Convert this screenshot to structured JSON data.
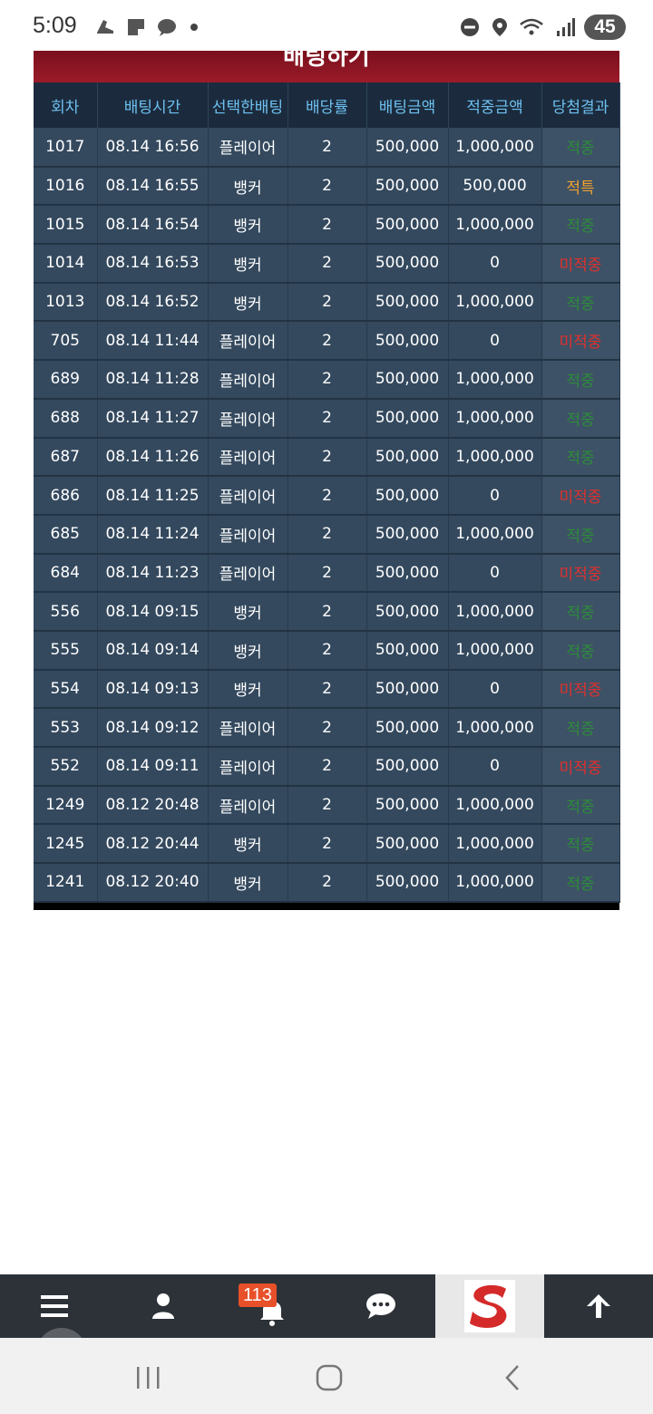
{
  "status_bar": {
    "time": "5:09",
    "battery": "45"
  },
  "panel": {
    "title": "배팅하기"
  },
  "table": {
    "headers": [
      "회차",
      "배팅시간",
      "선택한배팅",
      "배당률",
      "배팅금액",
      "적중금액",
      "당첨결과"
    ],
    "rows": [
      [
        "1017",
        "08.14 16:56",
        "플레이어",
        "2",
        "500,000",
        "1,000,000",
        "적중"
      ],
      [
        "1016",
        "08.14 16:55",
        "뱅커",
        "2",
        "500,000",
        "500,000",
        "적특"
      ],
      [
        "1015",
        "08.14 16:54",
        "뱅커",
        "2",
        "500,000",
        "1,000,000",
        "적중"
      ],
      [
        "1014",
        "08.14 16:53",
        "뱅커",
        "2",
        "500,000",
        "0",
        "미적중"
      ],
      [
        "1013",
        "08.14 16:52",
        "뱅커",
        "2",
        "500,000",
        "1,000,000",
        "적중"
      ],
      [
        "705",
        "08.14 11:44",
        "플레이어",
        "2",
        "500,000",
        "0",
        "미적중"
      ],
      [
        "689",
        "08.14 11:28",
        "플레이어",
        "2",
        "500,000",
        "1,000,000",
        "적중"
      ],
      [
        "688",
        "08.14 11:27",
        "플레이어",
        "2",
        "500,000",
        "1,000,000",
        "적중"
      ],
      [
        "687",
        "08.14 11:26",
        "플레이어",
        "2",
        "500,000",
        "1,000,000",
        "적중"
      ],
      [
        "686",
        "08.14 11:25",
        "플레이어",
        "2",
        "500,000",
        "0",
        "미적중"
      ],
      [
        "685",
        "08.14 11:24",
        "플레이어",
        "2",
        "500,000",
        "1,000,000",
        "적중"
      ],
      [
        "684",
        "08.14 11:23",
        "플레이어",
        "2",
        "500,000",
        "0",
        "미적중"
      ],
      [
        "556",
        "08.14 09:15",
        "뱅커",
        "2",
        "500,000",
        "1,000,000",
        "적중"
      ],
      [
        "555",
        "08.14 09:14",
        "뱅커",
        "2",
        "500,000",
        "1,000,000",
        "적중"
      ],
      [
        "554",
        "08.14 09:13",
        "뱅커",
        "2",
        "500,000",
        "0",
        "미적중"
      ],
      [
        "553",
        "08.14 09:12",
        "플레이어",
        "2",
        "500,000",
        "1,000,000",
        "적중"
      ],
      [
        "552",
        "08.14 09:11",
        "플레이어",
        "2",
        "500,000",
        "0",
        "미적중"
      ],
      [
        "1249",
        "08.12 20:48",
        "플레이어",
        "2",
        "500,000",
        "1,000,000",
        "적중"
      ],
      [
        "1245",
        "08.12 20:44",
        "뱅커",
        "2",
        "500,000",
        "1,000,000",
        "적중"
      ],
      [
        "1241",
        "08.12 20:40",
        "뱅커",
        "2",
        "500,000",
        "1,000,000",
        "적중"
      ]
    ],
    "result_colors": {
      "적중": "#2e8b3a",
      "적특": "#f0a030",
      "미적중": "#e0302e"
    }
  },
  "toolbar": {
    "items": [
      {
        "icon": "menu-icon"
      },
      {
        "icon": "user-icon"
      },
      {
        "icon": "bell-icon",
        "badge": "113"
      },
      {
        "icon": "chat-icon"
      },
      {
        "icon": "brand-logo"
      },
      {
        "icon": "arrow-up-icon"
      }
    ]
  },
  "colors": {
    "header_red": "#9b1b2a",
    "table_bg": "#34495e",
    "header_text": "#6ec0f0"
  }
}
